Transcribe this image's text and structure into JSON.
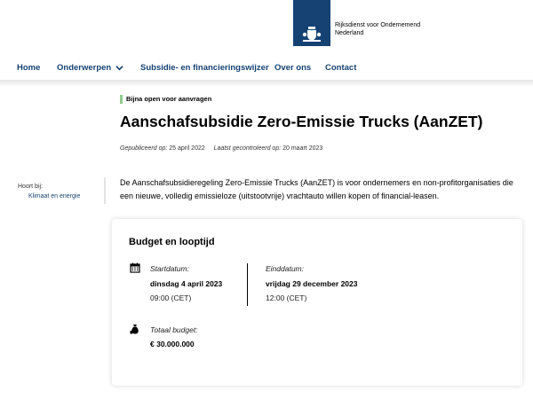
{
  "logo": {
    "line1": "Rijksdienst voor Ondernemend",
    "line2": "Nederland"
  },
  "nav": {
    "items": [
      {
        "label": "Home"
      },
      {
        "label": "Onderwerpen"
      },
      {
        "label": "Subsidie- en financieringswijzer"
      },
      {
        "label": "Over ons"
      },
      {
        "label": "Contact"
      }
    ]
  },
  "status": "Bijna open voor aanvragen",
  "page": {
    "title": "Aanschafsubsidie Zero-Emissie Trucks (AanZET)",
    "published_label": "Gepubliceerd op:",
    "published_date": "25 april 2022",
    "checked_label": "Laatst gecontroleerd op:",
    "checked_date": "20 maart 2023",
    "intro": "De Aanschafsubsidieregeling Zero-Emissie Trucks (AanZET) is voor ondernemers en non-profitorganisaties die een nieuwe, volledig emissieloze (uitstootvrije) vrachtauto willen kopen of financial-leasen."
  },
  "sidebar": {
    "label": "Hoort bij:",
    "link": "Klimaat en energie"
  },
  "card": {
    "title": "Budget en looptijd",
    "start": {
      "label": "Startdatum:",
      "date": "dinsdag 4 april 2023",
      "time": "09:00 (CET)"
    },
    "end": {
      "label": "Einddatum:",
      "date": "vrijdag 29 december 2023",
      "time": "12:00 (CET)"
    },
    "budget": {
      "label": "Totaal budget:",
      "value": "€ 30.000.000"
    }
  },
  "colors": {
    "brand": "#154273",
    "status_bar": "#8fcb8a"
  }
}
